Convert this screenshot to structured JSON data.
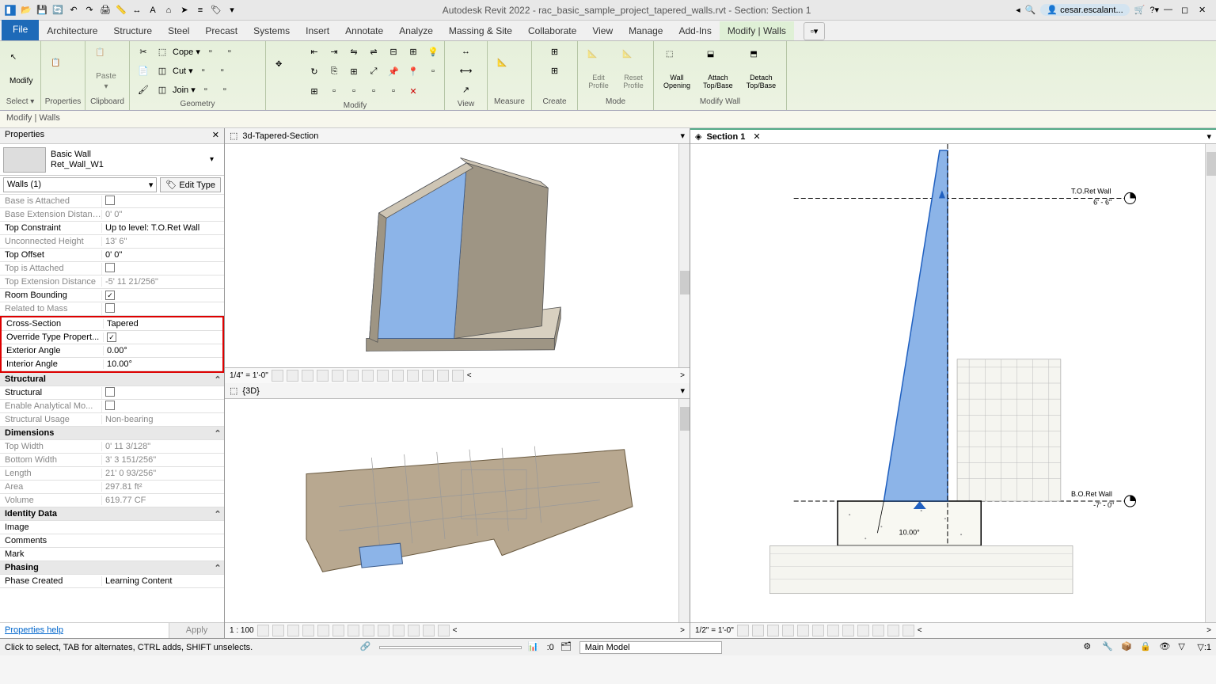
{
  "app": {
    "title": "Autodesk Revit 2022 - rac_basic_sample_project_tapered_walls.rvt - Section: Section 1",
    "user": "cesar.escalant..."
  },
  "ribbon_tabs": {
    "file": "File",
    "items": [
      "Architecture",
      "Structure",
      "Steel",
      "Precast",
      "Systems",
      "Insert",
      "Annotate",
      "Analyze",
      "Massing & Site",
      "Collaborate",
      "View",
      "Manage",
      "Add-Ins"
    ],
    "active": "Modify | Walls"
  },
  "ribbon": {
    "select": "Select ▾",
    "modify": "Modify",
    "properties": "Properties",
    "paste": "Paste",
    "clipboard": "Clipboard",
    "cope": "Cope ▾",
    "cut": "Cut ▾",
    "join": "Join ▾",
    "geometry": "Geometry",
    "modify_grp": "Modify",
    "view": "View",
    "measure": "Measure",
    "create": "Create",
    "edit_profile": "Edit Profile",
    "reset_profile": "Reset Profile",
    "mode": "Mode",
    "wall_opening": "Wall Opening",
    "attach": "Attach Top/Base",
    "detach": "Detach Top/Base",
    "modify_wall": "Modify Wall"
  },
  "options_bar": "Modify | Walls",
  "props": {
    "title": "Properties",
    "type_family": "Basic Wall",
    "type_name": "Ret_Wall_W1",
    "instance": "Walls (1)",
    "edit_type": "Edit Type",
    "rows": [
      {
        "n": "Base is Attached",
        "v": "",
        "ro": true,
        "chk": false
      },
      {
        "n": "Base Extension Distance",
        "v": "0'  0\"",
        "ro": true
      },
      {
        "n": "Top Constraint",
        "v": "Up to level: T.O.Ret Wall"
      },
      {
        "n": "Unconnected Height",
        "v": "13'  6\"",
        "ro": true
      },
      {
        "n": "Top Offset",
        "v": "0'  0\""
      },
      {
        "n": "Top is Attached",
        "v": "",
        "ro": true,
        "chk": false
      },
      {
        "n": "Top Extension Distance",
        "v": "-5'  11 21/256\"",
        "ro": true
      },
      {
        "n": "Room Bounding",
        "v": "",
        "chk": true
      },
      {
        "n": "Related to Mass",
        "v": "",
        "ro": true,
        "chk": false
      },
      {
        "n": "Cross-Section",
        "v": "Tapered",
        "hl": true
      },
      {
        "n": "Override Type Propert...",
        "v": "",
        "chk": true,
        "hl": true
      },
      {
        "n": "Exterior Angle",
        "v": "0.00°",
        "hl": true
      },
      {
        "n": "Interior Angle",
        "v": "10.00°",
        "hl": true
      }
    ],
    "group_structural": "Structural",
    "rows2": [
      {
        "n": "Structural",
        "v": "",
        "chk": false
      },
      {
        "n": "Enable Analytical Mo...",
        "v": "",
        "ro": true,
        "chk": false
      },
      {
        "n": "Structural Usage",
        "v": "Non-bearing",
        "ro": true
      }
    ],
    "group_dims": "Dimensions",
    "rows3": [
      {
        "n": "Top Width",
        "v": "0'  11 3/128\"",
        "ro": true
      },
      {
        "n": "Bottom Width",
        "v": "3'  3 151/256\"",
        "ro": true
      },
      {
        "n": "Length",
        "v": "21'  0 93/256\"",
        "ro": true
      },
      {
        "n": "Area",
        "v": "297.81 ft²",
        "ro": true
      },
      {
        "n": "Volume",
        "v": "619.77 CF",
        "ro": true
      }
    ],
    "group_id": "Identity Data",
    "rows4": [
      {
        "n": "Image",
        "v": ""
      },
      {
        "n": "Comments",
        "v": ""
      },
      {
        "n": "Mark",
        "v": ""
      }
    ],
    "group_phasing": "Phasing",
    "rows5": [
      {
        "n": "Phase Created",
        "v": "Learning Content"
      }
    ],
    "help": "Properties help",
    "apply": "Apply"
  },
  "views": {
    "v1": "3d-Tapered-Section",
    "v2": "{3D}",
    "v3": "Section 1",
    "scale1": "1/4\" = 1'-0\"",
    "scale2": "1 : 100",
    "scale3": "1/2\" = 1'-0\""
  },
  "section": {
    "top_level": "T.O.Ret Wall",
    "top_dim": "6' - 6\"",
    "bot_level": "B.O.Ret Wall",
    "bot_dim": "-7' - 0\"",
    "angle": "10.00°"
  },
  "status": {
    "hint": "Click to select, TAB for alternates, CTRL adds, SHIFT unselects.",
    "zero": ":0",
    "model": "Main Model",
    "filter": ":1"
  }
}
